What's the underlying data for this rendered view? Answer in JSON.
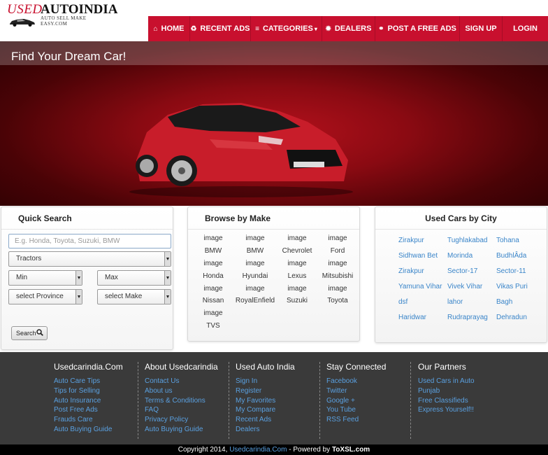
{
  "header": {
    "logo": {
      "used": "USED",
      "auto": "AUTOINDIA",
      "tagline": "AUTO SELL MAKE EASY.COM"
    },
    "nav": [
      {
        "label": "HOME",
        "icon": "home-icon"
      },
      {
        "label": "RECENT ADS",
        "icon": "recycle-icon"
      },
      {
        "label": "CATEGORIES",
        "icon": "menu-icon",
        "caret": "▾"
      },
      {
        "label": "DEALERS",
        "icon": "gear-icon"
      },
      {
        "label": "POST A FREE ADS",
        "icon": "share-icon"
      },
      {
        "label": "SIGN UP",
        "icon": ""
      },
      {
        "label": "LOGIN",
        "icon": ""
      }
    ]
  },
  "hero": {
    "title": "Find Your Dream Car!"
  },
  "quick_search": {
    "title": "Quick Search",
    "search_placeholder": "E.g. Honda, Toyota, Suzuki, BMW",
    "category_value": "Tractors",
    "min_value": "Min",
    "max_value": "Max",
    "province_value": "select Province",
    "make_value": "select Make",
    "search_button": "Search"
  },
  "browse_by_make": {
    "title": "Browse by Make",
    "cells": [
      "image",
      "image",
      "image",
      "image",
      "BMW",
      "BMW",
      "Chevrolet",
      "Ford",
      "image",
      "image",
      "image",
      "image",
      "Honda",
      "Hyundai",
      "Lexus",
      "Mitsubishi",
      "image",
      "image",
      "image",
      "image",
      "Nissan",
      "RoyalEnfield",
      "Suzuki",
      "Toyota",
      "image",
      "",
      "",
      "",
      "TVS",
      "",
      "",
      ""
    ]
  },
  "used_cars_by_city": {
    "title": "Used Cars by City",
    "cities": [
      "Zirakpur",
      "Tughlakabad",
      "Tohana",
      "Sidhwan Bet",
      "Morinda",
      "BudhlÂda",
      "Zirakpur",
      "Sector-17",
      "Sector-11",
      "Yamuna Vihar",
      "Vivek Vihar",
      "Vikas Puri",
      "dsf",
      "lahor",
      "Bagh",
      "Haridwar",
      "Rudraprayag",
      "Dehradun"
    ]
  },
  "footer": {
    "columns": [
      {
        "title": "Usedcarindia.Com",
        "links": [
          "Auto Care Tips",
          "Tips for Selling",
          "Auto Insurance",
          "Post Free Ads",
          "Frauds Care",
          "Auto Buying Guide"
        ]
      },
      {
        "title": "About Usedcarindia",
        "links": [
          "Contact Us",
          "About us",
          "Terms & Conditions",
          "FAQ",
          "Privacy Policy",
          "Auto Buying Guide"
        ]
      },
      {
        "title": "Used Auto India",
        "links": [
          "Sign In",
          "Register",
          "My Favorites",
          "My Compare",
          "Recent Ads",
          "Dealers"
        ]
      },
      {
        "title": "Stay Connected",
        "links": [
          "Facebook",
          "Twitter",
          "Google +",
          "You Tube",
          "RSS Feed"
        ]
      },
      {
        "title": "Our Partners",
        "links": [
          "Used Cars in Auto",
          "Punjab",
          "Free Classifieds",
          "Express Yourself!!"
        ]
      }
    ],
    "copyright": {
      "prefix": "Copyright 2014, ",
      "site": "Usedcarindia.Com",
      "middle": " - Powered by ",
      "powered": "ToXSL.com"
    }
  },
  "colors": {
    "brand_red": "#c8102e",
    "link_blue": "#3a85c9",
    "footer_bg": "#3a3a3a"
  }
}
